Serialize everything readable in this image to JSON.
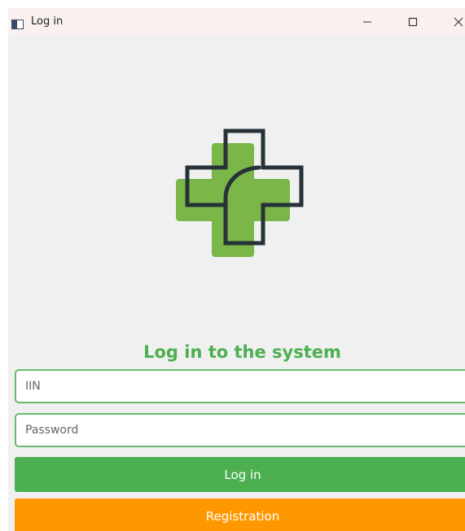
{
  "window": {
    "title": "Log in",
    "controls": {
      "minimize_icon": "minimize-icon",
      "maximize_icon": "maximize-icon",
      "close_icon": "close-icon"
    }
  },
  "logo": {
    "icon": "medical-cross-logo",
    "fill_color": "#7ab648",
    "outline_color": "#263238"
  },
  "form": {
    "heading": "Log in to the system",
    "iin_placeholder": "IIN",
    "password_placeholder": "Password",
    "login_label": "Log in",
    "register_label": "Registration"
  },
  "colors": {
    "accent_green": "#4caf50",
    "accent_orange": "#ff9800",
    "field_border": "#66bb6a"
  }
}
